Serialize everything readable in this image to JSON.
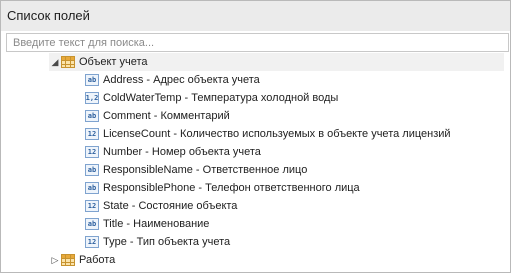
{
  "panel": {
    "title": "Список полей",
    "search_placeholder": "Введите текст для поиска..."
  },
  "tree": {
    "root": {
      "label": "Объект учета",
      "expander": "◢"
    },
    "fields": [
      {
        "icon": "ab",
        "label": "Address - Адрес объекта учета"
      },
      {
        "icon": "1,2",
        "label": "ColdWaterTemp - Температура холодной воды"
      },
      {
        "icon": "ab",
        "label": "Comment - Комментарий"
      },
      {
        "icon": "12",
        "label": "LicenseCount - Количество используемых в объекте учета лицензий"
      },
      {
        "icon": "12",
        "label": "Number - Номер объекта учета"
      },
      {
        "icon": "ab",
        "label": "ResponsibleName - Ответственное лицо"
      },
      {
        "icon": "ab",
        "label": "ResponsiblePhone - Телефон ответственного лица"
      },
      {
        "icon": "12",
        "label": "State - Состояние объекта"
      },
      {
        "icon": "ab",
        "label": "Title - Наименование"
      },
      {
        "icon": "12",
        "label": "Type - Тип объекта учета"
      }
    ],
    "sibling": {
      "label": "Работа",
      "expander": "▷"
    }
  }
}
